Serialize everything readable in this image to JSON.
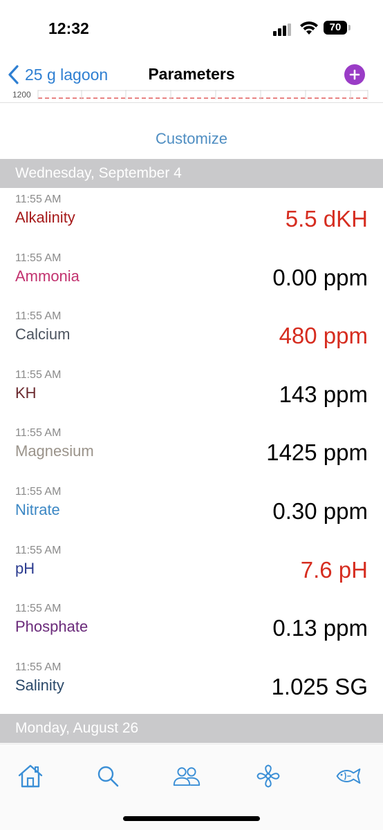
{
  "status_bar": {
    "time": "12:32",
    "battery": "70"
  },
  "nav": {
    "back_label": "25 g lagoon",
    "title": "Parameters",
    "add_icon": "plus-circle-icon",
    "accent_color": "#2e7fd2",
    "add_color": "#9a3cc6"
  },
  "chart": {
    "tick_label": "1200"
  },
  "customize_label": "Customize",
  "sections": [
    {
      "header": "Wednesday, September 4",
      "entries": [
        {
          "time": "11:55 AM",
          "name": "Alkalinity",
          "value": "5.5 dKH",
          "name_color": "#a61b1b",
          "value_color": "#d62d20"
        },
        {
          "time": "11:55 AM",
          "name": "Ammonia",
          "value": "0.00 ppm",
          "name_color": "#c2326f",
          "value_color": "#000000"
        },
        {
          "time": "11:55 AM",
          "name": "Calcium",
          "value": "480 ppm",
          "name_color": "#4d5560",
          "value_color": "#d62d20"
        },
        {
          "time": "11:55 AM",
          "name": "KH",
          "value": "143 ppm",
          "name_color": "#6b2a2f",
          "value_color": "#000000"
        },
        {
          "time": "11:55 AM",
          "name": "Magnesium",
          "value": "1425 ppm",
          "name_color": "#9a938a",
          "value_color": "#000000"
        },
        {
          "time": "11:55 AM",
          "name": "Nitrate",
          "value": "0.30 ppm",
          "name_color": "#3b87c4",
          "value_color": "#000000"
        },
        {
          "time": "11:55 AM",
          "name": "pH",
          "value": "7.6 pH",
          "name_color": "#2a3a8f",
          "value_color": "#d62d20"
        },
        {
          "time": "11:55 AM",
          "name": "Phosphate",
          "value": "0.13 ppm",
          "name_color": "#6a2a7a",
          "value_color": "#000000"
        },
        {
          "time": "11:55 AM",
          "name": "Salinity",
          "value": "1.025 SG",
          "name_color": "#2c4a6a",
          "value_color": "#000000"
        }
      ]
    },
    {
      "header": "Monday, August 26",
      "entries": []
    }
  ],
  "tabs": [
    {
      "icon": "home-icon"
    },
    {
      "icon": "search-icon"
    },
    {
      "icon": "people-icon"
    },
    {
      "icon": "fan-icon"
    },
    {
      "icon": "fish-icon"
    }
  ]
}
